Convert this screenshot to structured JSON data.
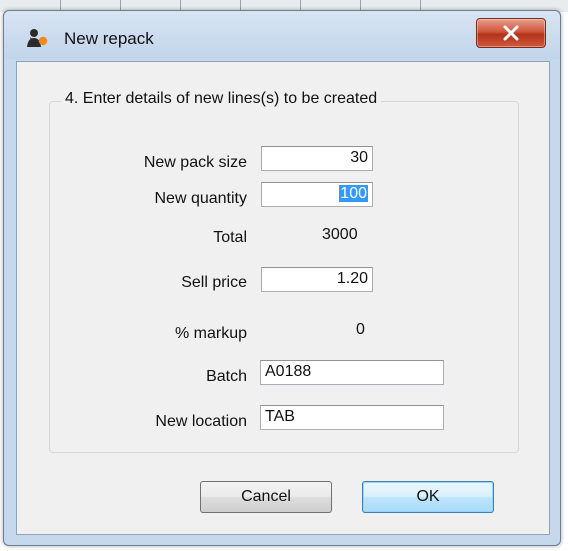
{
  "window": {
    "title": "New repack",
    "app_icon": "person-with-orange-dot-icon",
    "close_icon": "close-x-icon"
  },
  "step": {
    "heading": "4. Enter details of new lines(s) to be created"
  },
  "form": {
    "new_pack_size": {
      "label": "New pack size",
      "value": "30"
    },
    "new_quantity": {
      "label": "New quantity",
      "value": "100",
      "selected": true
    },
    "total": {
      "label": "Total",
      "value": "3000"
    },
    "sell_price": {
      "label": "Sell price",
      "value": "1.20"
    },
    "markup": {
      "label": "% markup",
      "value": "0"
    },
    "batch": {
      "label": "Batch",
      "value": "A0188"
    },
    "new_location": {
      "label": "New location",
      "value": "TAB"
    }
  },
  "buttons": {
    "cancel": "Cancel",
    "ok": "OK"
  },
  "colors": {
    "selection": "#3399ff",
    "close_button": "#c8452b",
    "window_frame": "#c6d8ec"
  }
}
